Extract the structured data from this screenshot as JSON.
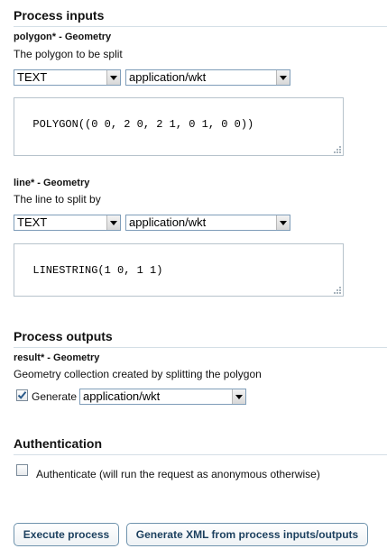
{
  "inputs": {
    "title": "Process inputs",
    "polygon": {
      "title": "polygon* - Geometry",
      "description": "The polygon to be split",
      "format_type": "TEXT",
      "mime_type": "application/wkt",
      "value": "POLYGON((0 0, 2 0, 2 1, 0 1, 0 0))"
    },
    "line": {
      "title": "line* - Geometry",
      "description": "The line to split by",
      "format_type": "TEXT",
      "mime_type": "application/wkt",
      "value": "LINESTRING(1 0, 1 1)"
    }
  },
  "outputs": {
    "title": "Process outputs",
    "result": {
      "title": "result* - Geometry",
      "description": "Geometry collection created by splitting the polygon",
      "generate_label": "Generate",
      "generate_checked": true,
      "mime_type": "application/wkt"
    }
  },
  "authentication": {
    "title": "Authentication",
    "label": "Authenticate (will run the request as anonymous otherwise)",
    "checked": false
  },
  "actions": {
    "execute_label": "Execute process",
    "generate_xml_label": "Generate XML from process inputs/outputs"
  },
  "colors": {
    "rule": "#d4dfe6",
    "button_text": "#1b3f5e",
    "button_border": "#6f93ad"
  }
}
